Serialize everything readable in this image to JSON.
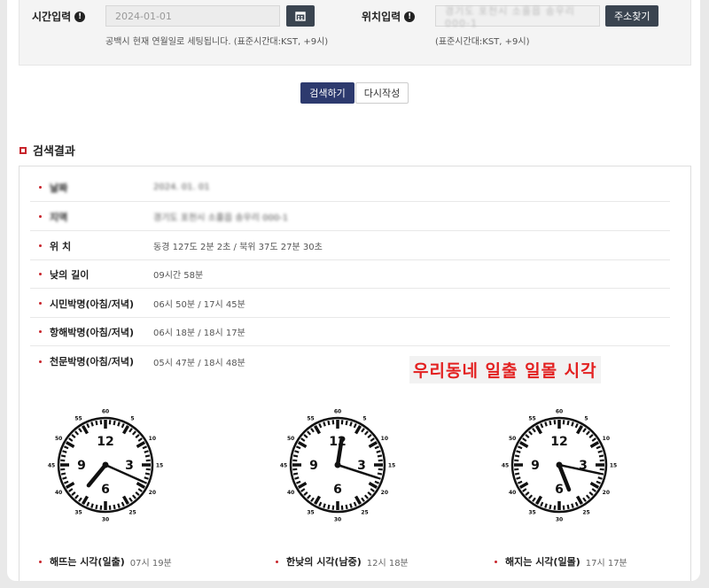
{
  "form": {
    "time_label": "시간입력",
    "date_value": "2024-01-01",
    "time_help": "공백시 현재 연월일로 세팅됩니다. (표준시간대:KST, +9시)",
    "location_label": "위치입력",
    "location_value": "경기도 포천시 소흘읍 송우리 000-1",
    "address_button": "주소찾기",
    "location_help": "(표준시간대:KST, +9시)",
    "info_glyph": "!",
    "calendar_icon": "calendar-icon"
  },
  "actions": {
    "search": "검색하기",
    "reset": "다시작성"
  },
  "results": {
    "title": "검색결과",
    "rows": [
      {
        "key": "날짜",
        "value": "2024. 01. 01"
      },
      {
        "key": "지역",
        "value": "경기도 포천시 소흘읍 송우리 000-1"
      },
      {
        "key": "위 치",
        "value": "동경 127도 2분 2초 / 북위 37도 27분 30초"
      },
      {
        "key": "낮의 길이",
        "value": "09시간 58분"
      },
      {
        "key": "시민박명(아침/저녁)",
        "value": "06시 50분 / 17시 45분"
      },
      {
        "key": "항해박명(아침/저녁)",
        "value": "06시 18분 / 18시 17분"
      },
      {
        "key": "천문박명(아침/저녁)",
        "value": "05시 47분 / 18시 48분"
      }
    ]
  },
  "headline": "우리동네 일출 일몰 시각",
  "clock_labels": {
    "hours": [
      "12",
      "3",
      "6",
      "9"
    ],
    "minutes": [
      "60",
      "5",
      "10",
      "15",
      "20",
      "25",
      "30",
      "35",
      "40",
      "45",
      "50",
      "55"
    ]
  },
  "clocks": [
    {
      "caption": "해뜨는 시각(일출)",
      "time": "07시 19분",
      "hour": 7,
      "minute": 19
    },
    {
      "caption": "한낮의 시각(남중)",
      "time": "12시 18분",
      "hour": 12,
      "minute": 18
    },
    {
      "caption": "해지는 시각(일몰)",
      "time": "17시 17분",
      "hour": 17,
      "minute": 17
    }
  ],
  "colors": {
    "primary_button": "#2d3a6e",
    "dark_button": "#3a4450",
    "accent_red": "#c8252c",
    "headline_red": "#e32020"
  }
}
